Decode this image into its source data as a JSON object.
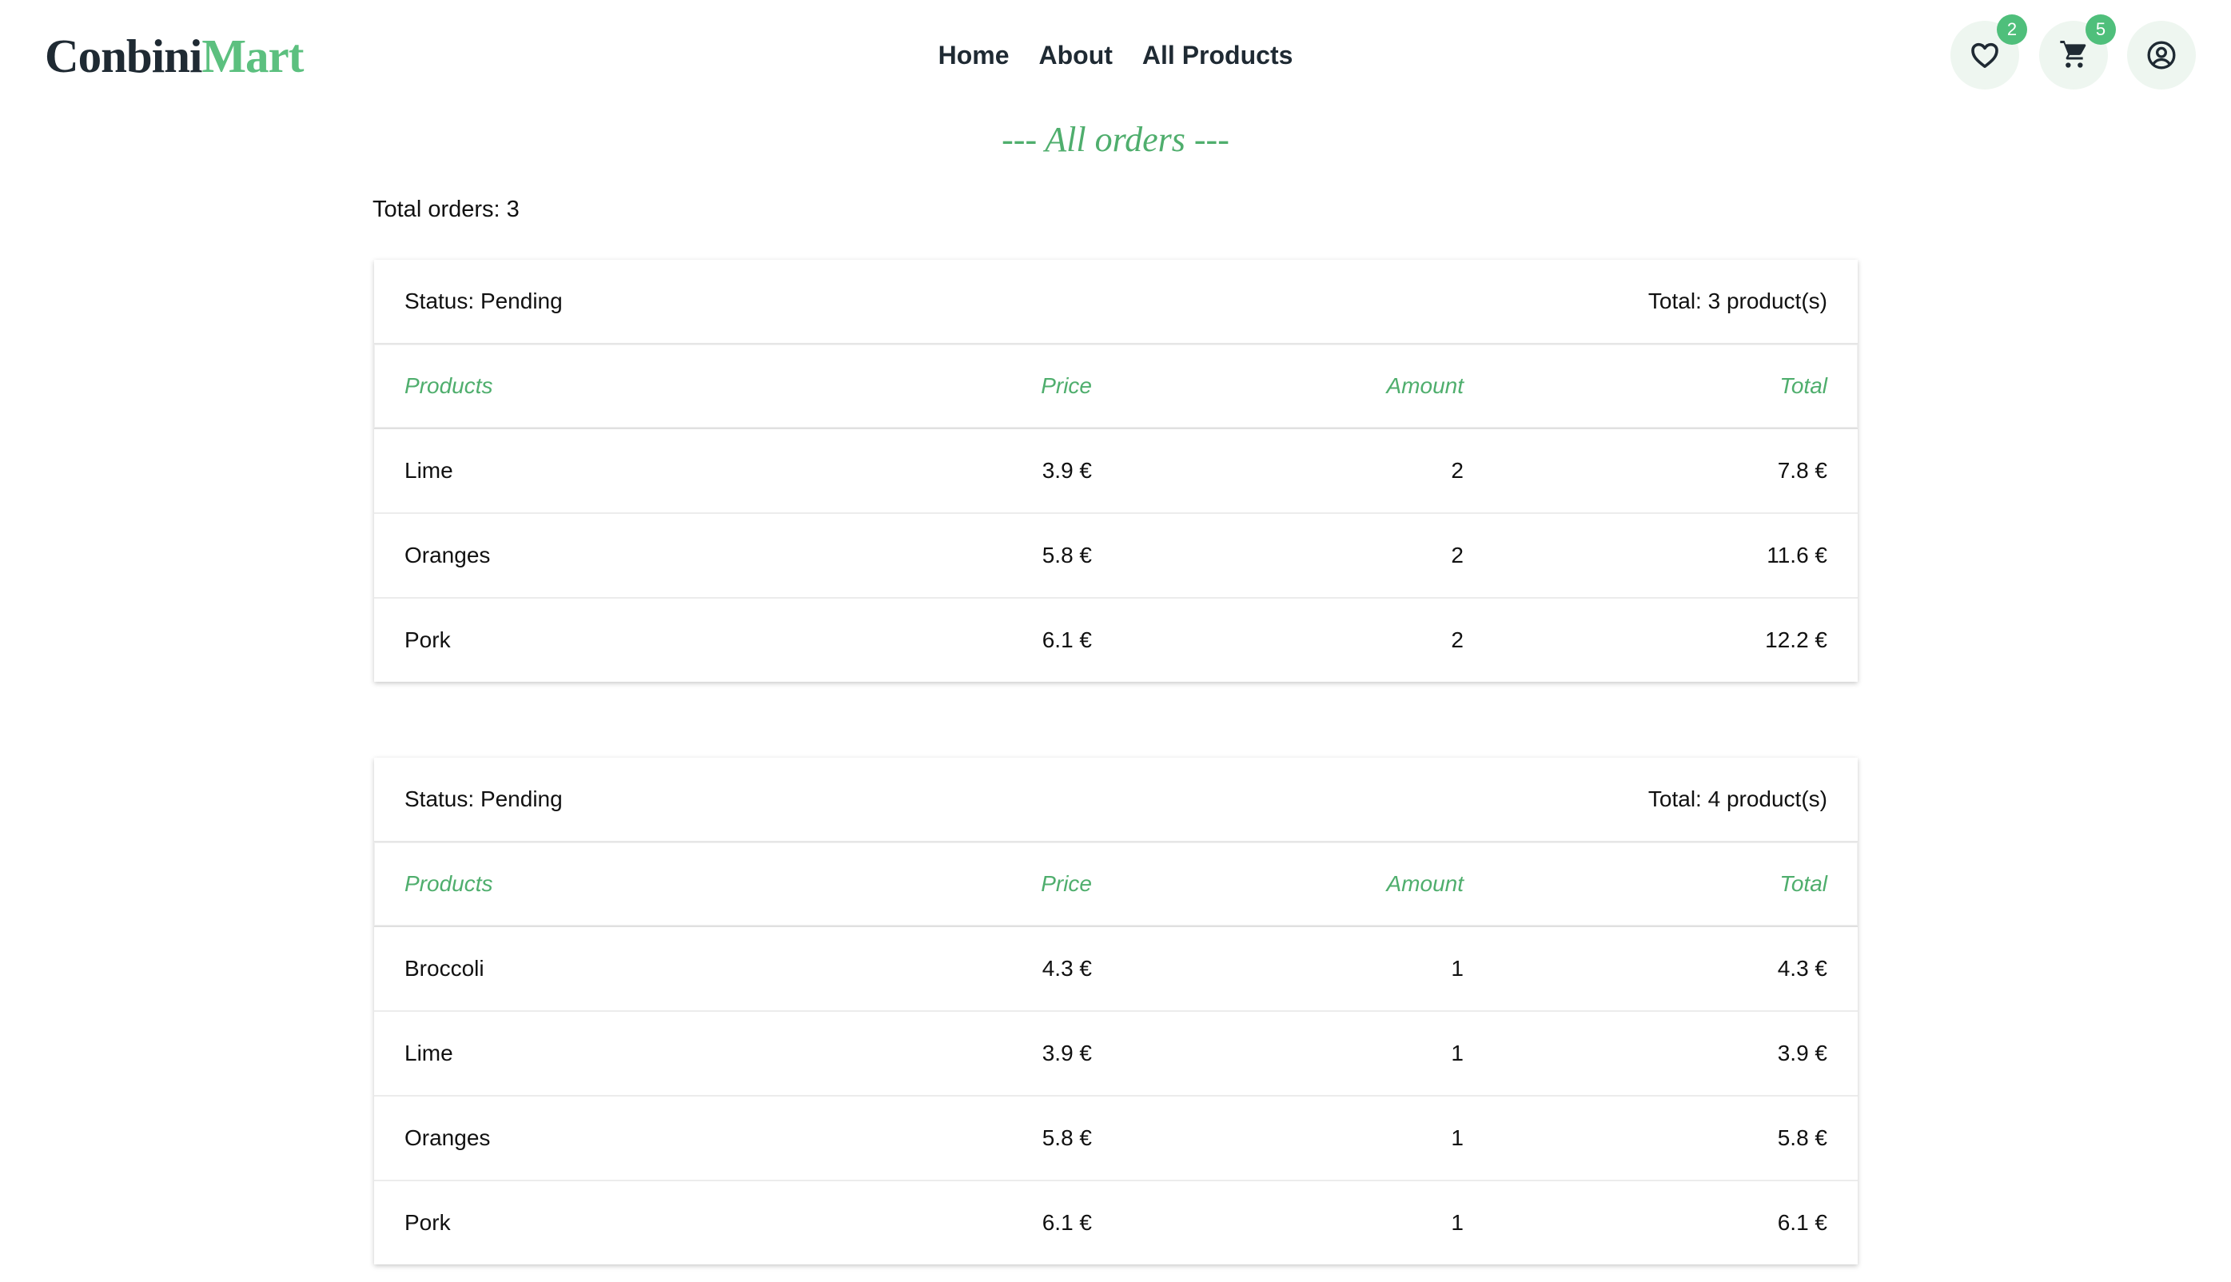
{
  "brand": {
    "part1": "Conbini",
    "part2": "Mart"
  },
  "nav": {
    "home": "Home",
    "about": "About",
    "all_products": "All Products"
  },
  "badges": {
    "wishlist": "2",
    "cart": "5"
  },
  "icons": {
    "wishlist": "heart-icon",
    "cart": "cart-icon",
    "account": "user-circle-icon"
  },
  "colors": {
    "accent": "#4fae6d",
    "badge": "#4fbf7b",
    "dark": "#1f2a33"
  },
  "page_title": "--- All orders ---",
  "total_orders_label": "Total orders: 3",
  "columns": {
    "products": "Products",
    "price": "Price",
    "amount": "Amount",
    "total": "Total"
  },
  "orders": [
    {
      "status": "Status: Pending",
      "total": "Total: 3 product(s)",
      "items": [
        {
          "name": "Lime",
          "price": "3.9 €",
          "amount": "2",
          "total": "7.8 €"
        },
        {
          "name": "Oranges",
          "price": "5.8 €",
          "amount": "2",
          "total": "11.6 €"
        },
        {
          "name": "Pork",
          "price": "6.1 €",
          "amount": "2",
          "total": "12.2 €"
        }
      ]
    },
    {
      "status": "Status: Pending",
      "total": "Total: 4 product(s)",
      "items": [
        {
          "name": "Broccoli",
          "price": "4.3 €",
          "amount": "1",
          "total": "4.3 €"
        },
        {
          "name": "Lime",
          "price": "3.9 €",
          "amount": "1",
          "total": "3.9 €"
        },
        {
          "name": "Oranges",
          "price": "5.8 €",
          "amount": "1",
          "total": "5.8 €"
        },
        {
          "name": "Pork",
          "price": "6.1 €",
          "amount": "1",
          "total": "6.1 €"
        }
      ]
    }
  ]
}
